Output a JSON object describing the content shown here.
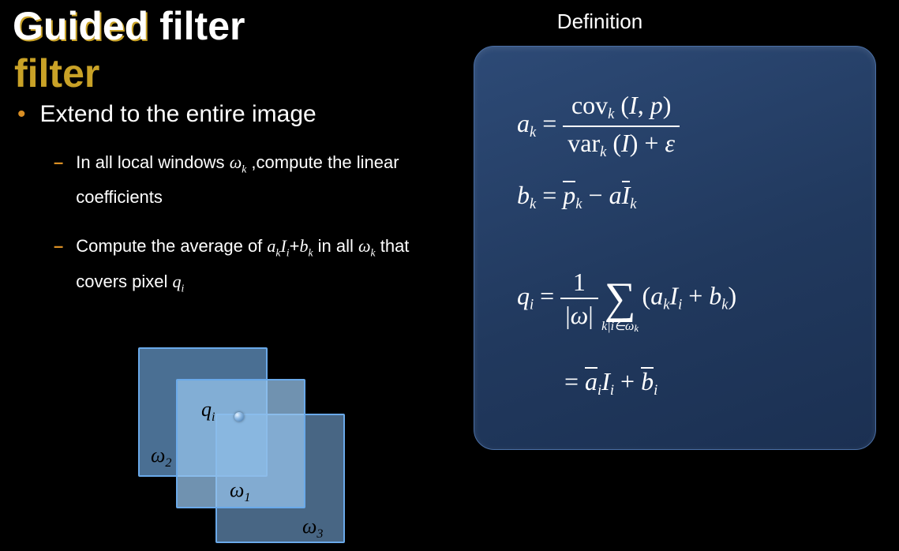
{
  "title": "Guided filter",
  "definition_label": "Definition",
  "body": {
    "bullet_main": "Extend to the entire image",
    "sub1_pre": "In all local windows ",
    "sub1_var": "ω",
    "sub1_varsub": "k",
    "sub1_post": " ,compute the linear coefficients",
    "sub2_pre": "Compute the average of ",
    "sub2_expr_a": "a",
    "sub2_expr_asub": "k",
    "sub2_expr_I": "I",
    "sub2_expr_Isub": "i",
    "sub2_plus": "+",
    "sub2_expr_b": "b",
    "sub2_expr_bsub": "k",
    "sub2_mid": " in all ",
    "sub2_var": "ω",
    "sub2_varsub": "k",
    "sub2_post": " that covers pixel ",
    "sub2_q": "q",
    "sub2_qsub": "i"
  },
  "eq": {
    "a": "a",
    "k": "k",
    "eq": " = ",
    "eq2": "= ",
    "cov": "cov",
    "var": "var",
    "I": "I",
    "p": "p",
    "i": "i",
    "lpar": "(",
    "rpar": ")",
    "comma": ", ",
    "plus": " + ",
    "minus": " − ",
    "eps": "ε",
    "b": "b",
    "pbar": "p",
    "Ibar": "I",
    "q": "q",
    "one": "1",
    "omega": "ω",
    "absL": "|",
    "absR": "|",
    "sum": "∑",
    "sum_under_pre": "k|i∈ω",
    "abar": "a",
    "bbar": "b"
  },
  "illus": {
    "qi": "q",
    "qi_sub": "i",
    "w1": "ω",
    "w1_sub": "1",
    "w2": "ω",
    "w2_sub": "2",
    "w3": "ω",
    "w3_sub": "3"
  }
}
